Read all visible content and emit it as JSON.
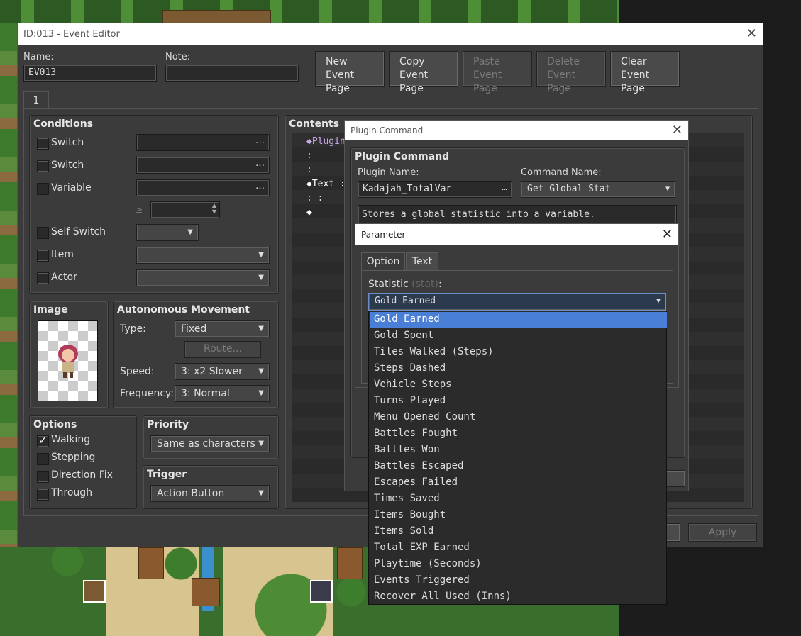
{
  "event_editor": {
    "title": "ID:013 - Event Editor",
    "name_label": "Name:",
    "name_value": "EV013",
    "note_label": "Note:",
    "note_value": "",
    "buttons": {
      "new_page": [
        "New",
        "Event Page"
      ],
      "copy_page": [
        "Copy",
        "Event Page"
      ],
      "paste_page": [
        "Paste",
        "Event Page"
      ],
      "delete_page": [
        "Delete",
        "Event Page"
      ],
      "clear_page": [
        "Clear",
        "Event Page"
      ]
    },
    "page_tab": "1",
    "conditions": {
      "title": "Conditions",
      "switch1": "Switch",
      "switch2": "Switch",
      "variable": "Variable",
      "ge_symbol": "≥",
      "self_switch": "Self Switch",
      "item": "Item",
      "actor": "Actor",
      "ellipsis": "…"
    },
    "image": {
      "title": "Image"
    },
    "autonomous": {
      "title": "Autonomous Movement",
      "type_label": "Type:",
      "type_value": "Fixed",
      "route_button": "Route...",
      "speed_label": "Speed:",
      "speed_value": "3: x2 Slower",
      "freq_label": "Frequency:",
      "freq_value": "3: Normal"
    },
    "options": {
      "title": "Options",
      "walking": "Walking",
      "stepping": "Stepping",
      "direction_fix": "Direction Fix",
      "through": "Through"
    },
    "priority": {
      "title": "Priority",
      "value": "Same as characters"
    },
    "trigger": {
      "title": "Trigger",
      "value": "Action Button"
    },
    "contents": {
      "title": "Contents",
      "line1": "◆Plugin",
      "line2": ":",
      "line3": ":",
      "line4": "◆Text :",
      "line5": ":     :",
      "line6": "◆"
    },
    "apply_button": "Apply"
  },
  "plugin_command": {
    "title": "Plugin Command",
    "group_title": "Plugin Command",
    "plugin_name_label": "Plugin Name:",
    "plugin_name_value": "Kadajah_TotalVar",
    "command_name_label": "Command Name:",
    "command_name_value": "Get Global Stat",
    "description": "Stores a global statistic into a variable."
  },
  "parameter": {
    "title": "Parameter",
    "tab_option": "Option",
    "tab_text": "Text",
    "statistic_label": "Statistic",
    "statistic_key": "(stat)",
    "statistic_colon": ":",
    "selected": "Gold Earned",
    "options": [
      "Gold Earned",
      "Gold Spent",
      "Tiles Walked (Steps)",
      "Steps Dashed",
      "Vehicle Steps",
      "Turns Played",
      "Menu Opened Count",
      "Battles Fought",
      "Battles Won",
      "Battles Escaped",
      "Escapes Failed",
      "Times Saved",
      "Items Bought",
      "Items Sold",
      "Total EXP Earned",
      "Playtime (Seconds)",
      "Events Triggered",
      "Recover All Used (Inns)"
    ]
  },
  "icons": [
    "close-icon",
    "checkmark-icon",
    "chevron-down-icon",
    "ellipsis-icon",
    "diamond-icon",
    "character-sprite"
  ]
}
